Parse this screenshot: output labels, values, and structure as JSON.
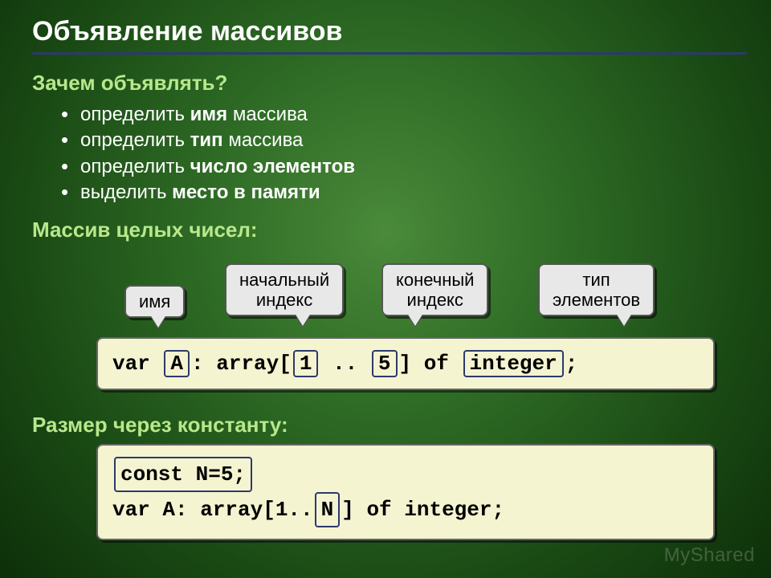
{
  "title": "Объявление массивов",
  "section1": {
    "heading": "Зачем объявлять?",
    "items": [
      {
        "pre": "определить ",
        "b": "имя",
        "post": " массива"
      },
      {
        "pre": "определить ",
        "b": "тип",
        "post": " массива"
      },
      {
        "pre": "определить ",
        "b": "число элементов",
        "post": ""
      },
      {
        "pre": "выделить ",
        "b": "место в памяти",
        "post": ""
      }
    ]
  },
  "section2": {
    "heading": "Массив целых чисел:",
    "callouts": {
      "name": "имя",
      "start": "начальный\nиндекс",
      "end": "конечный\nиндекс",
      "type": "тип\nэлементов"
    },
    "code": {
      "p1": "var ",
      "arr_name": "A",
      "p2": ": array[",
      "idx_start": "1",
      "p3": " .. ",
      "idx_end": "5",
      "p4": "] of ",
      "elem_type": "integer",
      "p5": ";"
    }
  },
  "section3": {
    "heading": "Размер через константу:",
    "code": {
      "const_line": "const N=5;",
      "l2a": "var A: array[1..",
      "n": "N",
      "l2b": "] of integer;"
    }
  },
  "watermark": "MyShared"
}
